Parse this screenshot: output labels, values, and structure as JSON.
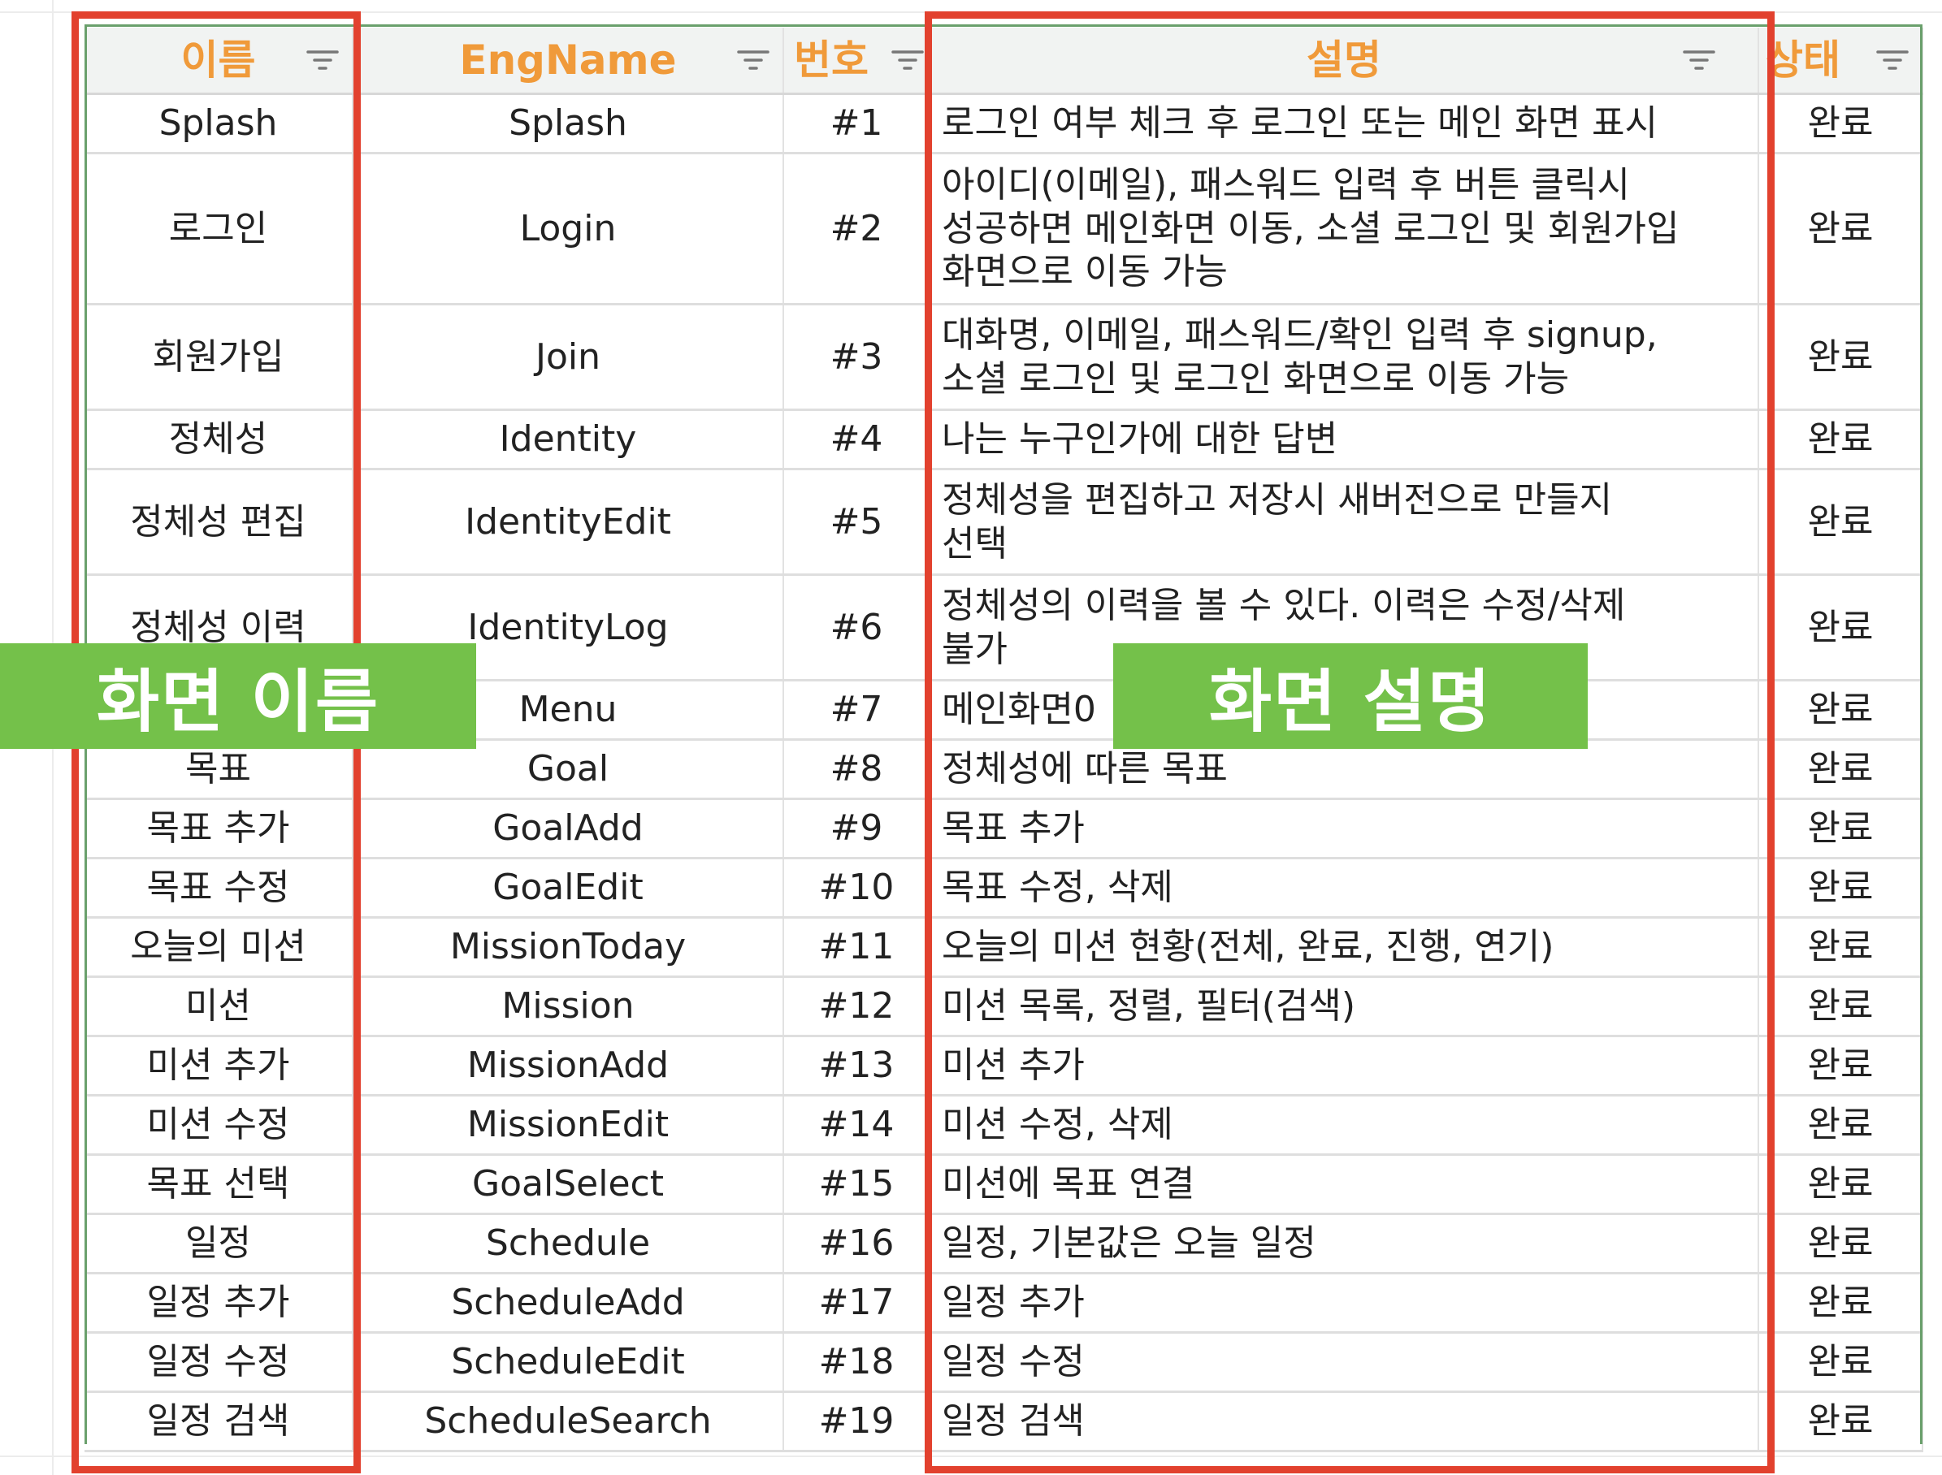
{
  "columns": {
    "name": "이름",
    "eng": "EngName",
    "num": "번호",
    "desc": "설명",
    "status": "상태"
  },
  "rows": [
    {
      "name": "Splash",
      "eng": "Splash",
      "num": "#1",
      "desc": [
        "로그인 여부 체크 후 로그인 또는 메인 화면 표시"
      ],
      "status": "완료"
    },
    {
      "name": "로그인",
      "eng": "Login",
      "num": "#2",
      "desc": [
        "아이디(이메일), 패스워드 입력 후 버튼 클릭시",
        "성공하면 메인화면 이동, 소셜 로그인 및 회원가입",
        "화면으로 이동 가능"
      ],
      "status": "완료"
    },
    {
      "name": "회원가입",
      "eng": "Join",
      "num": "#3",
      "desc": [
        "대화명, 이메일, 패스워드/확인 입력 후 signup,",
        "소셜 로그인 및 로그인 화면으로 이동 가능"
      ],
      "status": "완료"
    },
    {
      "name": "정체성",
      "eng": "Identity",
      "num": "#4",
      "desc": [
        "나는 누구인가에 대한 답변"
      ],
      "status": "완료"
    },
    {
      "name": "정체성 편집",
      "eng": "IdentityEdit",
      "num": "#5",
      "desc": [
        "정체성을 편집하고 저장시 새버전으로 만들지",
        "선택"
      ],
      "status": "완료"
    },
    {
      "name": "정체성 이력",
      "eng": "IdentityLog",
      "num": "#6",
      "desc": [
        "정체성의 이력을 볼 수 있다. 이력은 수정/삭제",
        "불가"
      ],
      "status": "완료"
    },
    {
      "name": "",
      "eng": "Menu",
      "num": "#7",
      "desc": [
        "메인화면0"
      ],
      "status": "완료"
    },
    {
      "name": "목표",
      "eng": "Goal",
      "num": "#8",
      "desc": [
        "정체성에 따른 목표"
      ],
      "status": "완료"
    },
    {
      "name": "목표 추가",
      "eng": "GoalAdd",
      "num": "#9",
      "desc": [
        "목표 추가"
      ],
      "status": "완료"
    },
    {
      "name": "목표 수정",
      "eng": "GoalEdit",
      "num": "#10",
      "desc": [
        "목표 수정, 삭제"
      ],
      "status": "완료"
    },
    {
      "name": "오늘의 미션",
      "eng": "MissionToday",
      "num": "#11",
      "desc": [
        "오늘의 미션 현황(전체, 완료, 진행, 연기)"
      ],
      "status": "완료"
    },
    {
      "name": "미션",
      "eng": "Mission",
      "num": "#12",
      "desc": [
        "미션 목록, 정렬, 필터(검색)"
      ],
      "status": "완료"
    },
    {
      "name": "미션 추가",
      "eng": "MissionAdd",
      "num": "#13",
      "desc": [
        "미션 추가"
      ],
      "status": "완료"
    },
    {
      "name": "미션 수정",
      "eng": "MissionEdit",
      "num": "#14",
      "desc": [
        "미션 수정, 삭제"
      ],
      "status": "완료"
    },
    {
      "name": "목표 선택",
      "eng": "GoalSelect",
      "num": "#15",
      "desc": [
        "미션에 목표 연결"
      ],
      "status": "완료"
    },
    {
      "name": "일정",
      "eng": "Schedule",
      "num": "#16",
      "desc": [
        "일정, 기본값은 오늘 일정"
      ],
      "status": "완료"
    },
    {
      "name": "일정 추가",
      "eng": "ScheduleAdd",
      "num": "#17",
      "desc": [
        "일정 추가"
      ],
      "status": "완료"
    },
    {
      "name": "일정 수정",
      "eng": "ScheduleEdit",
      "num": "#18",
      "desc": [
        "일정 수정"
      ],
      "status": "완료"
    },
    {
      "name": "일정 검색",
      "eng": "ScheduleSearch",
      "num": "#19",
      "desc": [
        "일정 검색"
      ],
      "status": "완료"
    }
  ],
  "callouts": {
    "screen_name": "화면 이름",
    "screen_desc": "화면 설명"
  },
  "colors": {
    "header_text": "#f09a3a",
    "highlight_box": "#e2412e",
    "callout_bg": "#74c14a",
    "table_frame": "#6aa06c"
  },
  "icons": {
    "filter": "filter-icon"
  }
}
